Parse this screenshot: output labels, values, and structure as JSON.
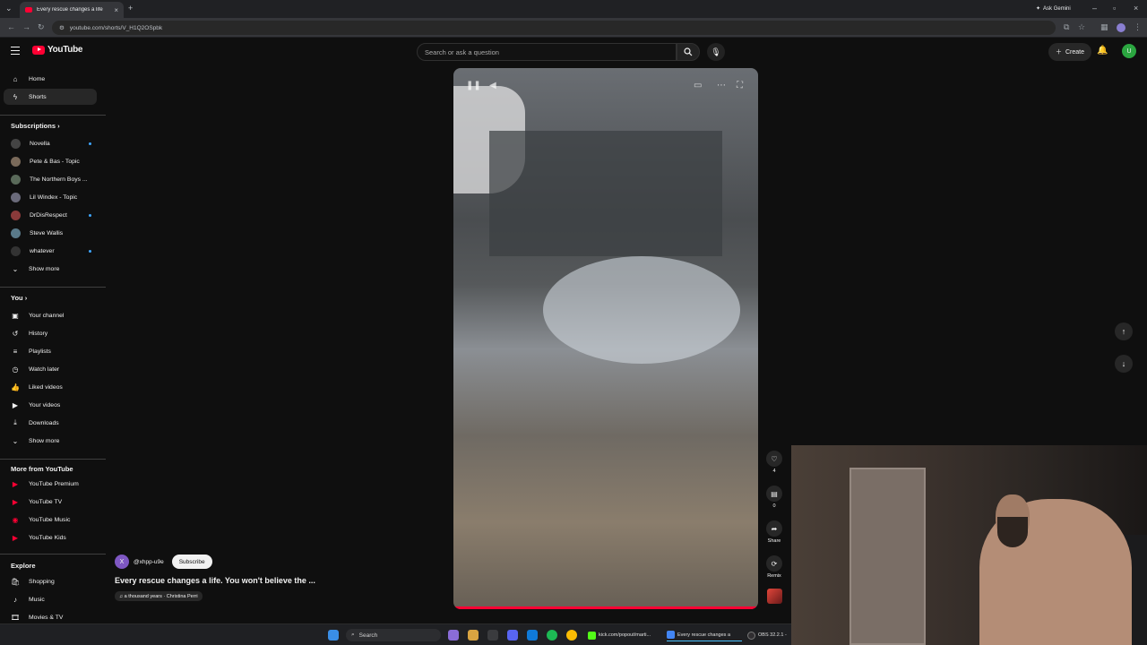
{
  "browser": {
    "tab_title": "Every rescue changes a life",
    "tab_close": "×",
    "new_tab": "+",
    "gemini_label": "Ask Gemini",
    "url": "youtube.com/shorts/V_H1Q2OSpbk",
    "window_controls": [
      "–",
      "▫",
      "×"
    ]
  },
  "header": {
    "logo_text": "YouTube",
    "search_placeholder": "Search or ask a question",
    "create_label": "Create",
    "avatar_letter": "U"
  },
  "sidebar": {
    "main": [
      {
        "label": "Home",
        "icon": "home-icon"
      },
      {
        "label": "Shorts",
        "icon": "shorts-icon"
      }
    ],
    "subscriptions_heading": "Subscriptions",
    "subscriptions": [
      {
        "label": "Novella",
        "color": "#444444",
        "dot": true
      },
      {
        "label": "Pete & Bas - Topic",
        "color": "#7a6a5a",
        "dot": false
      },
      {
        "label": "The Northern Boys ...",
        "color": "#5a6a5a",
        "dot": false
      },
      {
        "label": "Lil Windex - Topic",
        "color": "#6a6a7a",
        "dot": false
      },
      {
        "label": "DrDisRespect",
        "color": "#8a3a3a",
        "dot": true
      },
      {
        "label": "Steve Wallis",
        "color": "#5a7a8a",
        "dot": false
      },
      {
        "label": "whatever",
        "color": "#333333",
        "dot": true
      },
      {
        "label": "Show more",
        "color": "",
        "dot": false
      }
    ],
    "you_heading": "You",
    "you_items": [
      {
        "label": "Your channel"
      },
      {
        "label": "History"
      },
      {
        "label": "Playlists"
      },
      {
        "label": "Watch later"
      },
      {
        "label": "Liked videos"
      },
      {
        "label": "Your videos"
      },
      {
        "label": "Downloads"
      },
      {
        "label": "Show more"
      }
    ],
    "more_heading": "More from YouTube",
    "more_items": [
      {
        "label": "YouTube Premium"
      },
      {
        "label": "YouTube TV"
      },
      {
        "label": "YouTube Music"
      },
      {
        "label": "YouTube Kids"
      }
    ],
    "explore_heading": "Explore",
    "explore_items": [
      {
        "label": "Shopping"
      },
      {
        "label": "Music"
      },
      {
        "label": "Movies & TV"
      }
    ]
  },
  "short": {
    "channel_initial": "X",
    "channel_name": "@xhpp-u9e",
    "subscribe_label": "Subscribe",
    "title": "Every rescue changes a life. You won't believe the ...",
    "music": "♫ a thousand years · Christina Perri",
    "likes": "4",
    "comments": "0",
    "share_label": "Share",
    "remix_label": "Remix",
    "progress": 1.0
  },
  "taskbar": {
    "search_label": "Search",
    "apps": [
      {
        "label": "kick.com/popout/marti...",
        "color": "#53fc18"
      },
      {
        "label": "Every rescue changes a",
        "color": "#4285f4"
      },
      {
        "label": "OBS 32.2.1 -",
        "color": "#302e31"
      }
    ]
  },
  "colors": {
    "accent": "#ff0033",
    "background": "#0f0f0f",
    "surface": "#272727"
  }
}
